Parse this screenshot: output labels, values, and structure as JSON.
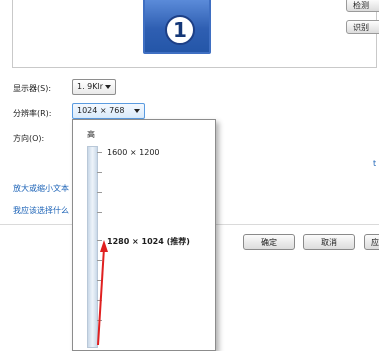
{
  "preview": {
    "monitor_number": "1",
    "buttons": [
      "检测",
      "识别"
    ]
  },
  "settings": {
    "display_label": "显示器(S):",
    "display_value": "1. 9Klr",
    "resolution_label": "分辨率(R):",
    "resolution_value": "1024 × 768",
    "orientation_label": "方向(O):"
  },
  "links": [
    "放大或缩小文本",
    "我应该选择什么"
  ],
  "partial_link_char": "t",
  "dropdown": {
    "top_label": "高",
    "options": [
      {
        "text": "1600 × 1200",
        "bold": false
      },
      {
        "text": "1280 × 1024 (推荐)",
        "bold": true
      }
    ],
    "annotation_color": "#e02020"
  },
  "footer_buttons": [
    "确定",
    "取消",
    "应"
  ],
  "colors": {
    "accent": "#3f6fc2",
    "link": "#1c63b7"
  }
}
